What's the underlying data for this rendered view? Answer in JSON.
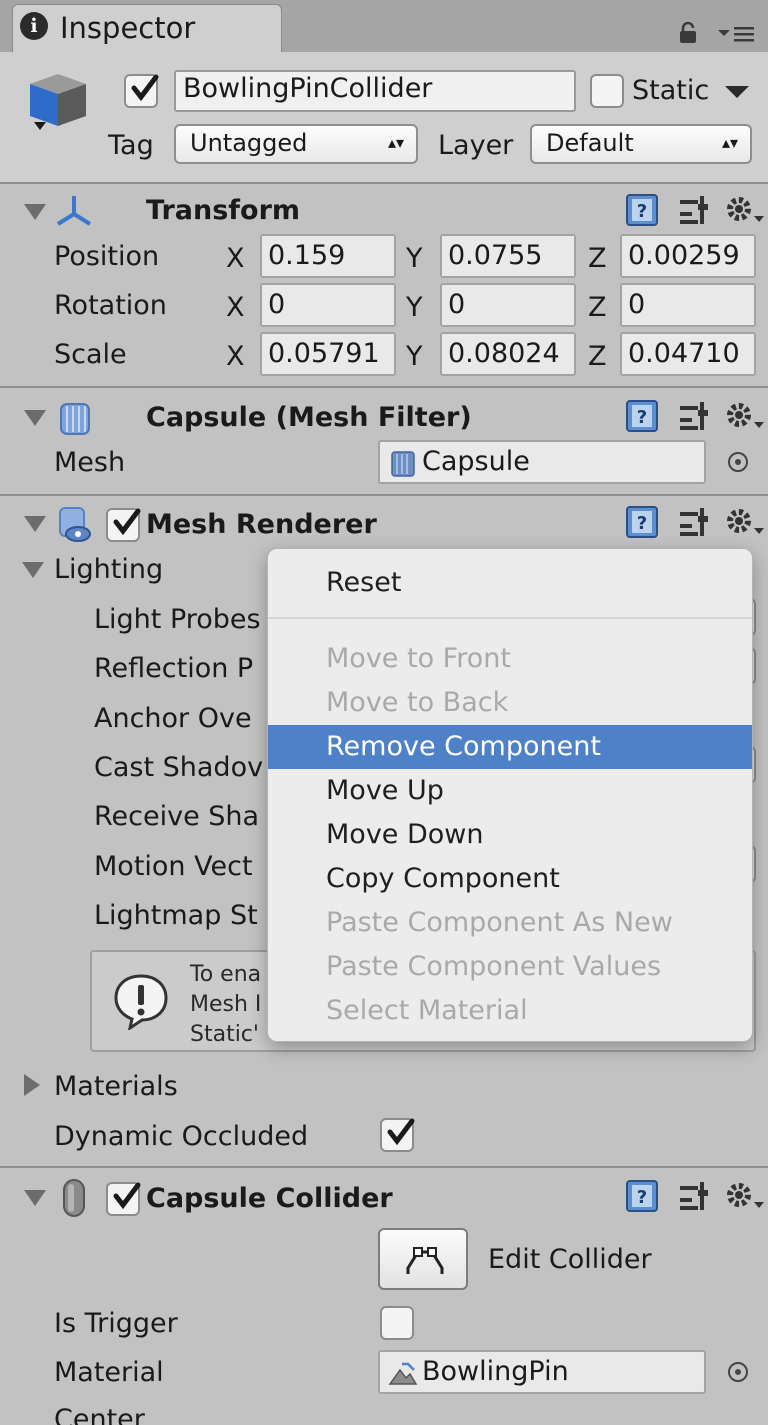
{
  "tab": {
    "title": "Inspector"
  },
  "object": {
    "name": "BowlingPinCollider",
    "static_label": "Static",
    "tag_label": "Tag",
    "tag_value": "Untagged",
    "layer_label": "Layer",
    "layer_value": "Default"
  },
  "transform": {
    "title": "Transform",
    "rows": [
      {
        "label": "Position",
        "x": "0.159",
        "y": "0.0755",
        "z": "0.00259"
      },
      {
        "label": "Rotation",
        "x": "0",
        "y": "0",
        "z": "0"
      },
      {
        "label": "Scale",
        "x": "0.05791",
        "y": "0.08024",
        "z": "0.04710"
      }
    ],
    "axis_x": "X",
    "axis_y": "Y",
    "axis_z": "Z"
  },
  "mesh_filter": {
    "title": "Capsule (Mesh Filter)",
    "mesh_label": "Mesh",
    "mesh_value": "Capsule"
  },
  "mesh_renderer": {
    "title": "Mesh Renderer",
    "lighting_label": "Lighting",
    "rows": [
      "Light Probes",
      "Reflection P",
      "Anchor Ove",
      "Cast Shadov",
      "Receive Sha",
      "Motion Vect",
      "Lightmap St"
    ],
    "info_lines": [
      "To ena",
      "Mesh I",
      "Static'"
    ],
    "materials_label": "Materials",
    "dynamic_occluded_label": "Dynamic Occluded"
  },
  "context_menu": {
    "items": [
      {
        "label": "Reset",
        "enabled": true
      },
      {
        "label": "Move to Front",
        "enabled": false
      },
      {
        "label": "Move to Back",
        "enabled": false
      },
      {
        "label": "Remove Component",
        "enabled": true,
        "highlighted": true
      },
      {
        "label": "Move Up",
        "enabled": true
      },
      {
        "label": "Move Down",
        "enabled": true
      },
      {
        "label": "Copy Component",
        "enabled": true
      },
      {
        "label": "Paste Component As New",
        "enabled": false
      },
      {
        "label": "Paste Component Values",
        "enabled": false
      },
      {
        "label": "Select Material",
        "enabled": false
      }
    ]
  },
  "capsule_collider": {
    "title": "Capsule Collider",
    "edit_collider_label": "Edit Collider",
    "is_trigger_label": "Is Trigger",
    "material_label": "Material",
    "material_value": "BowlingPin",
    "center_label": "Center"
  },
  "colors": {
    "panel_bg": "#c2c2c2",
    "header_bg": "#cfcfcf",
    "menu_highlight": "#4f81c8",
    "menu_disabled_text": "#a9a9a9",
    "checkmark_blue": "#3f6fb0"
  }
}
